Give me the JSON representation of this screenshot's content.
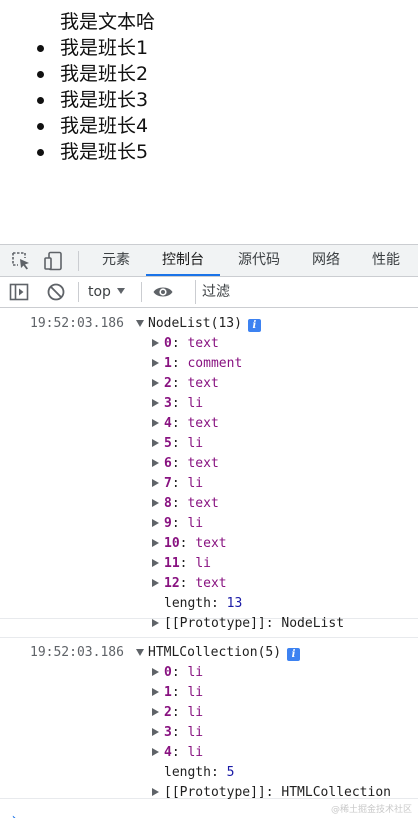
{
  "page": {
    "text_node": "我是文本哈",
    "list_items": [
      "我是班长1",
      "我是班长2",
      "我是班长3",
      "我是班长4",
      "我是班长5"
    ]
  },
  "devtools": {
    "tabs": [
      {
        "label": "元素",
        "active": false
      },
      {
        "label": "控制台",
        "active": true
      },
      {
        "label": "源代码",
        "active": false
      },
      {
        "label": "网络",
        "active": false
      },
      {
        "label": "性能",
        "active": false
      }
    ],
    "icons": {
      "inspect": "inspect-element-icon",
      "device": "device-toolbar-icon",
      "sidebar": "console-sidebar-icon",
      "clear": "clear-console-icon",
      "eye": "live-expression-icon",
      "info": "info-icon"
    },
    "toolbar": {
      "context": "top",
      "filter_placeholder": "过滤"
    },
    "accent_color": "#1a73e8"
  },
  "console": {
    "messages": [
      {
        "timestamp": "19:52:03.186",
        "title": "NodeList(13)",
        "info_glyph": "i",
        "items": [
          {
            "key": "0",
            "value": "text"
          },
          {
            "key": "1",
            "value": "comment"
          },
          {
            "key": "2",
            "value": "text"
          },
          {
            "key": "3",
            "value": "li"
          },
          {
            "key": "4",
            "value": "text"
          },
          {
            "key": "5",
            "value": "li"
          },
          {
            "key": "6",
            "value": "text"
          },
          {
            "key": "7",
            "value": "li"
          },
          {
            "key": "8",
            "value": "text"
          },
          {
            "key": "9",
            "value": "li"
          },
          {
            "key": "10",
            "value": "text"
          },
          {
            "key": "11",
            "value": "li"
          },
          {
            "key": "12",
            "value": "text"
          }
        ],
        "length_label": "length",
        "length_value": "13",
        "proto_label": "[[Prototype]]",
        "proto_value": "NodeList"
      },
      {
        "timestamp": "19:52:03.186",
        "title": "HTMLCollection(5)",
        "info_glyph": "i",
        "items": [
          {
            "key": "0",
            "value": "li"
          },
          {
            "key": "1",
            "value": "li"
          },
          {
            "key": "2",
            "value": "li"
          },
          {
            "key": "3",
            "value": "li"
          },
          {
            "key": "4",
            "value": "li"
          }
        ],
        "length_label": "length",
        "length_value": "5",
        "proto_label": "[[Prototype]]",
        "proto_value": "HTMLCollection"
      }
    ],
    "prompt_glyph": "›"
  },
  "watermark": "@稀土掘金技术社区"
}
